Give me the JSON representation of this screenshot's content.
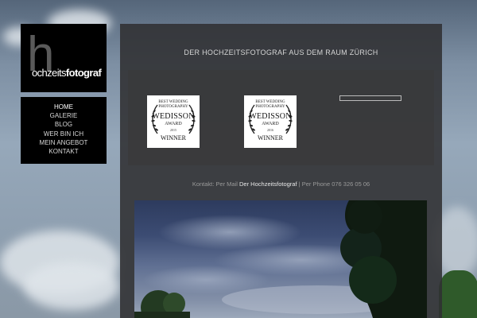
{
  "logo": {
    "letter": "h",
    "text_regular": "ochzeits",
    "text_bold": "fotograf"
  },
  "nav": {
    "items": [
      {
        "label": "HOME",
        "active": true
      },
      {
        "label": "GALERIE",
        "active": false
      },
      {
        "label": "BLOG",
        "active": false
      },
      {
        "label": "WER BIN ICH",
        "active": false
      },
      {
        "label": "MEIN ANGEBOT",
        "active": false
      },
      {
        "label": "KONTAKT",
        "active": false
      }
    ]
  },
  "header": {
    "tagline": "DER HOCHZEITSFOTOGRAF AUS DEM RAUM ZÜRICH"
  },
  "awards": [
    {
      "top_line1": "BEST WEDDING",
      "top_line2": "PHOTOGRAPHY",
      "name": "WEDISSON",
      "award": "AWARD",
      "year": "2015",
      "result": "WINNER"
    },
    {
      "top_line1": "BEST WEDDING",
      "top_line2": "PHOTOGRAPHY",
      "name": "WEDISSON",
      "award": "AWARD",
      "year": "2016",
      "result": "WINNER"
    }
  ],
  "search": {
    "value": "",
    "placeholder": ""
  },
  "contact": {
    "prefix": "Kontakt: Per Mail",
    "link": "Der Hochzeitsfotograf",
    "suffix": "| Per Phone 076 326 05 06"
  },
  "colors": {
    "panel": "#303032",
    "nav_bg": "#000000",
    "text": "#d6d6d6"
  }
}
